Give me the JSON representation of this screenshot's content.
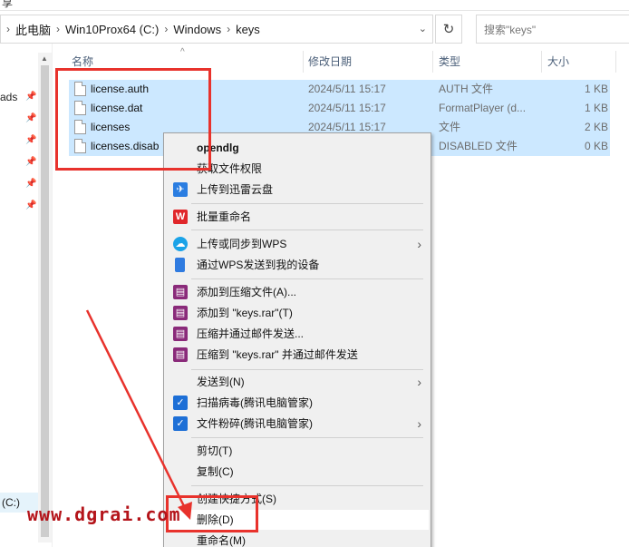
{
  "ribbon": {
    "text": "享"
  },
  "address": {
    "crumbs": [
      "此电脑",
      "Win10Prox64 (C:)",
      "Windows",
      "keys"
    ],
    "search_placeholder": "搜索\"keys\""
  },
  "nav": {
    "items": [
      "ads",
      "",
      "",
      "",
      "",
      ""
    ],
    "drive": "(C:)"
  },
  "columns": {
    "name": "名称",
    "date": "修改日期",
    "type": "类型",
    "size": "大小"
  },
  "files": [
    {
      "name": "license.auth",
      "date": "2024/5/11 15:17",
      "type": "AUTH 文件",
      "size": "1 KB"
    },
    {
      "name": "license.dat",
      "date": "2024/5/11 15:17",
      "type": "FormatPlayer (d...",
      "size": "1 KB"
    },
    {
      "name": "licenses",
      "date": "2024/5/11 15:17",
      "type": "文件",
      "size": "2 KB"
    },
    {
      "name": "licenses.disab",
      "date": "",
      "type": "DISABLED 文件",
      "size": "0 KB"
    }
  ],
  "menu": {
    "items": [
      {
        "label": "opendlg",
        "icon": ""
      },
      {
        "label": "获取文件权限",
        "icon": ""
      },
      {
        "label": "上传到迅雷云盘",
        "icon": "thunder-cloud-icon"
      },
      {
        "label": "批量重命名",
        "icon": "wps-icon"
      },
      {
        "label": "上传或同步到WPS",
        "icon": "cloud-icon"
      },
      {
        "label": "通过WPS发送到我的设备",
        "icon": "phone-icon"
      },
      {
        "label": "添加到压缩文件(A)...",
        "icon": "winrar-icon"
      },
      {
        "label": "添加到 \"keys.rar\"(T)",
        "icon": "winrar-icon"
      },
      {
        "label": "压缩并通过邮件发送...",
        "icon": "winrar-icon"
      },
      {
        "label": "压缩到 \"keys.rar\" 并通过邮件发送",
        "icon": "winrar-icon"
      },
      {
        "label": "发送到(N)",
        "icon": ""
      },
      {
        "label": "扫描病毒(腾讯电脑管家)",
        "icon": "tencent-shield-icon"
      },
      {
        "label": "文件粉碎(腾讯电脑管家)",
        "icon": "tencent-shield-icon"
      },
      {
        "label": "剪切(T)",
        "icon": ""
      },
      {
        "label": "复制(C)",
        "icon": ""
      },
      {
        "label": "创建快捷方式(S)",
        "icon": ""
      },
      {
        "label": "删除(D)",
        "icon": ""
      },
      {
        "label": "重命名(M)",
        "icon": ""
      }
    ]
  },
  "watermark": "www.dgrai.com",
  "colors": {
    "selection": "#cce8ff",
    "annotation_red": "#e8322c",
    "watermark": "#b4141a"
  }
}
